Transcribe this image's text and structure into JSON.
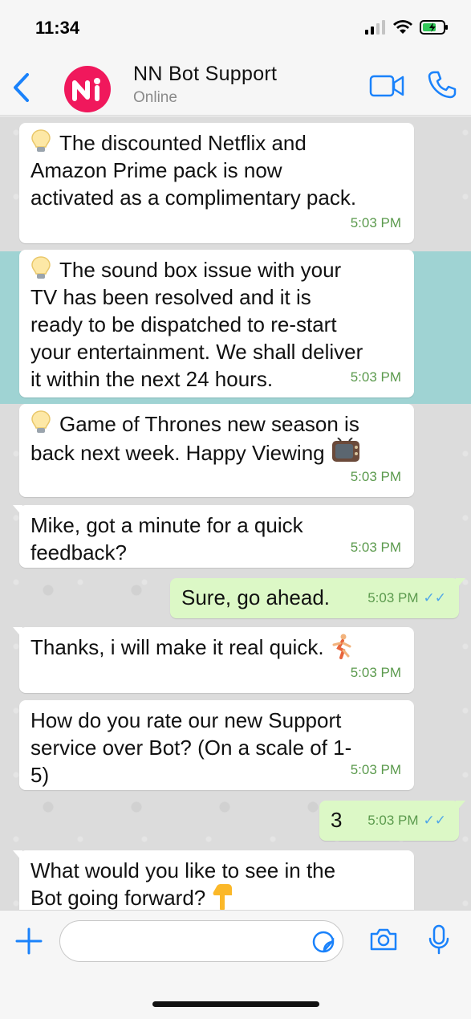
{
  "status_bar": {
    "time": "11:34"
  },
  "header": {
    "name": "NN Bot Support",
    "status": "Online"
  },
  "messages": [
    {
      "dir": "in",
      "icon": "bulb-icon",
      "text": "The discounted Netflix and\nAmazon Prime pack is now\nactivated as a complimentary pack.",
      "time": "5:03 PM"
    },
    {
      "dir": "in",
      "icon": "bulb-icon",
      "text": "The sound box issue with your\nTV has been resolved and it is\nready to be dispatched to re-start\nyour entertainment. We shall deliver\nit within the next 24 hours.",
      "time": "5:03 PM",
      "highlighted": true
    },
    {
      "dir": "in",
      "icon": "bulb-icon",
      "text": "Game of Thrones new season is\nback next week. Happy Viewing",
      "time": "5:03 PM",
      "trailing_icon": "tv-icon"
    },
    {
      "dir": "in",
      "text": "Mike, got a minute for a quick\nfeedback?",
      "time": "5:03 PM"
    },
    {
      "dir": "out",
      "text": "Sure, go ahead.",
      "time": "5:03 PM",
      "read": true
    },
    {
      "dir": "in",
      "text": "Thanks, i will make it real quick.",
      "time": "5:03 PM",
      "trailing_icon": "runner-icon"
    },
    {
      "dir": "in",
      "text": "How do you rate our new Support\nservice over Bot? (On a scale of 1-\n5)",
      "time": "5:03 PM"
    },
    {
      "dir": "out",
      "text": "3",
      "time": "5:03 PM",
      "read": true
    },
    {
      "dir": "in",
      "text": "What would you like to see in the\nBot going forward?",
      "time": "",
      "trailing_icon": "pointing-down-icon"
    }
  ],
  "input": {
    "placeholder": ""
  },
  "colors": {
    "accent": "#1a82fb",
    "outgoing_bubble": "#dcf8c6",
    "highlight_band": "#9fd3d3",
    "avatar": "#f0185c"
  }
}
